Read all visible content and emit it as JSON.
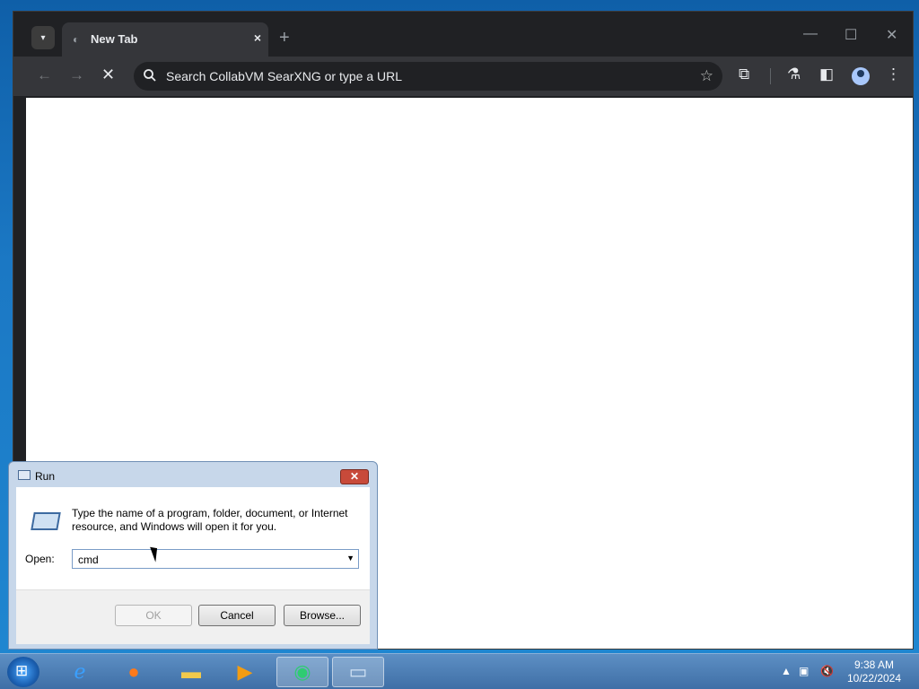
{
  "browser": {
    "tab_title": "New Tab",
    "omnibox_placeholder": "Search CollabVM SearXNG or type a URL",
    "new_tab_symbol": "+",
    "tab_close_symbol": "×"
  },
  "run_dialog": {
    "title": "Run",
    "description": "Type the name of a program, folder, document, or Internet resource, and Windows will open it for you.",
    "open_label": "Open:",
    "open_value": "cmd",
    "ok_label": "OK",
    "cancel_label": "Cancel",
    "browse_label": "Browse...",
    "close_symbol": "✕"
  },
  "taskbar": {
    "time": "9:38 AM",
    "date": "10/22/2024",
    "apps": [
      "internet-explorer",
      "firefox",
      "file-explorer",
      "media-player",
      "collabvm-browser",
      "run"
    ]
  },
  "colors": {
    "desktop": "#1b78c4",
    "browser_frame": "#202124",
    "toolbar": "#35363a",
    "run_close": "#c84a3a"
  }
}
